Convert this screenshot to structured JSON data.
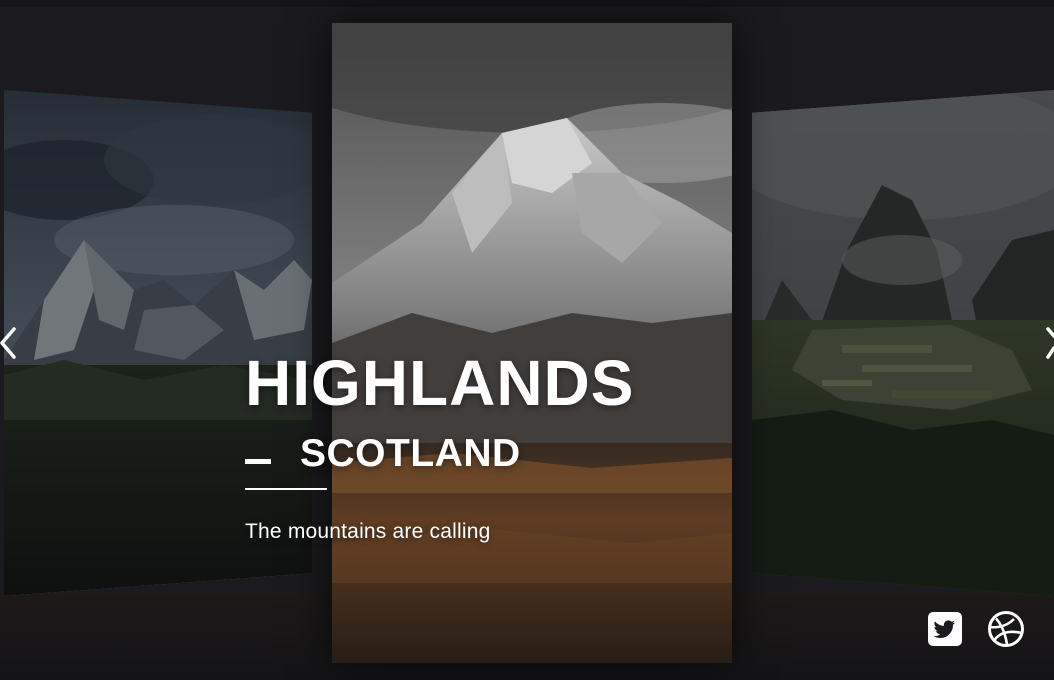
{
  "slide": {
    "title": "HIGHLANDS",
    "subtitle": "SCOTLAND",
    "tagline": "The mountains are calling"
  },
  "cards": {
    "left": {
      "icon": "mountain-peaks-image"
    },
    "center": {
      "icon": "snowy-mountain-image"
    },
    "right": {
      "icon": "machu-picchu-image"
    }
  },
  "navigation": {
    "prev_icon": "chevron-left-icon",
    "next_icon": "chevron-right-icon"
  },
  "social": [
    {
      "icon": "twitter-icon"
    },
    {
      "icon": "dribbble-icon"
    }
  ],
  "colors": {
    "background": "#1b1b1f",
    "text": "#ffffff"
  }
}
